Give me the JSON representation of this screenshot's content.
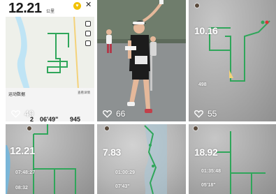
{
  "feed": {
    "tiles": [
      {
        "kind": "app-screenshot",
        "distance": "12.21",
        "unit": "公里",
        "section_title": "运动数据",
        "detail_link": "查看详情",
        "stats": [
          "2",
          "06'49\"",
          "945"
        ],
        "likes": "49"
      },
      {
        "kind": "photo",
        "likes": "66"
      },
      {
        "kind": "map",
        "distance": "10.16",
        "meta_value": "498",
        "likes": "55"
      },
      {
        "kind": "map",
        "distance": "12.21",
        "meta_lines": [
          "07:48:27",
          "08:32"
        ]
      },
      {
        "kind": "map",
        "distance": "7.83",
        "meta_lines": [
          "01:00:29",
          "07'43\""
        ]
      },
      {
        "kind": "map",
        "distance": "18.92",
        "meta_lines": [
          "01:35:48",
          "05'18\""
        ]
      }
    ]
  },
  "colors": {
    "route": "#2fa65a",
    "app_accent": "#f2c200",
    "shirt": "#1c1c1c",
    "skin": "#e5b89a"
  }
}
